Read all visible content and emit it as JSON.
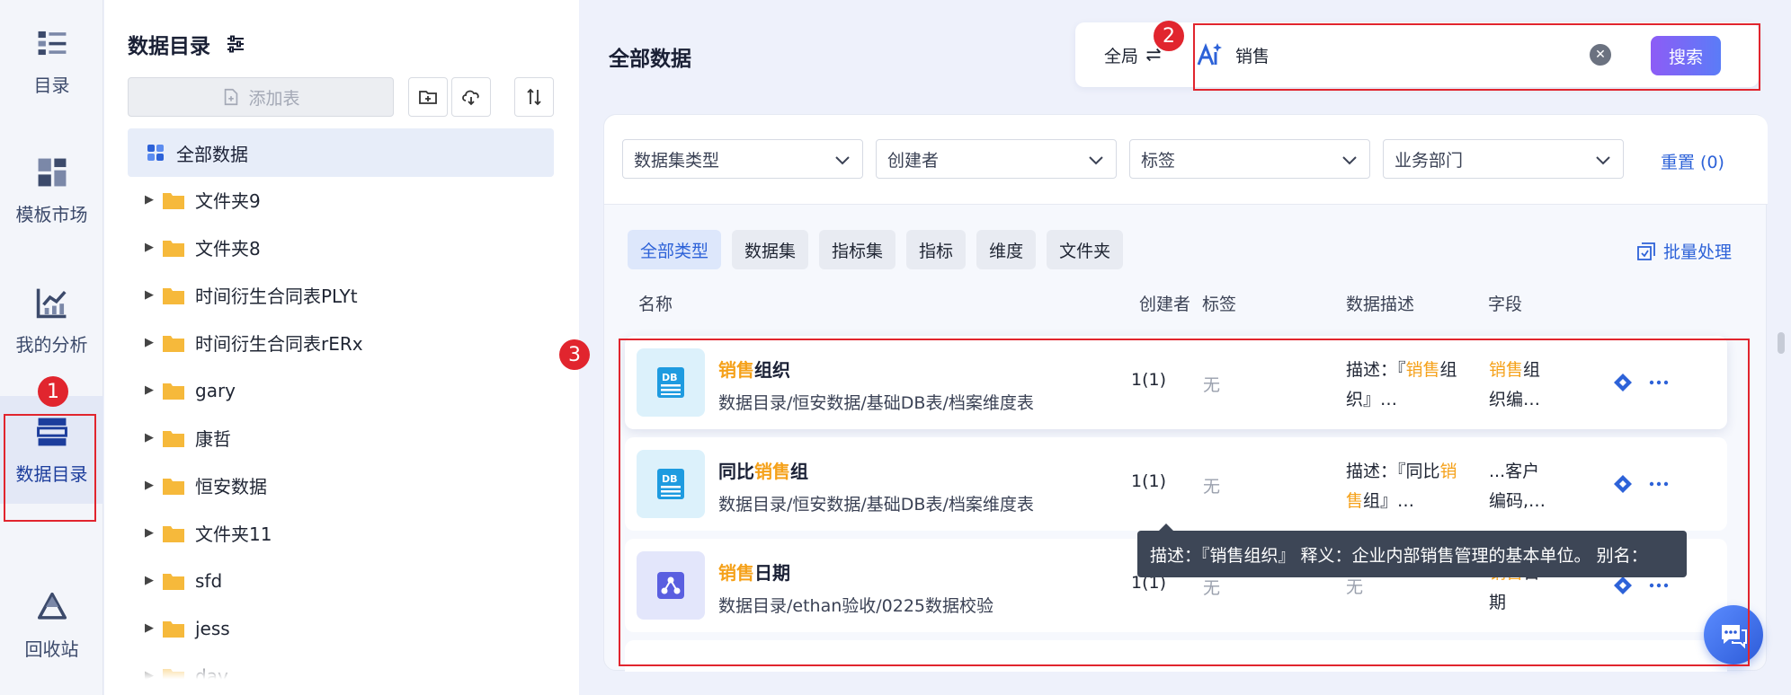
{
  "rail": {
    "items": [
      {
        "label": "目录",
        "icon": "catalog-list-icon"
      },
      {
        "label": "模板市场",
        "icon": "template-grid-icon"
      },
      {
        "label": "我的分析",
        "icon": "chart-analysis-icon"
      },
      {
        "label": "数据目录",
        "icon": "data-catalog-icon",
        "active": true
      },
      {
        "label": "回收站",
        "icon": "recycle-bin-icon"
      }
    ]
  },
  "tree": {
    "title": "数据目录",
    "add_table_label": "添加表",
    "all_label": "全部数据",
    "folders": [
      "文件夹9",
      "文件夹8",
      "时间衍生合同表PLYt",
      "时间衍生合同表rERx",
      "gary",
      "康哲",
      "恒安数据",
      "文件夹11",
      "sfd",
      "jess",
      "dav"
    ]
  },
  "main": {
    "title": "全部数据",
    "search": {
      "scope_label": "全局",
      "query": "销售",
      "button_label": "搜索"
    },
    "filters": [
      "数据集类型",
      "创建者",
      "标签",
      "业务部门"
    ],
    "reset_label": "重置 (0)",
    "type_tabs": [
      "全部类型",
      "数据集",
      "指标集",
      "指标",
      "维度",
      "文件夹"
    ],
    "batch_label": "批量处理",
    "columns": {
      "name": "名称",
      "creator": "创建者",
      "tags": "标签",
      "description": "数据描述",
      "fields": "字段"
    },
    "rows": [
      {
        "name_hl": "销售",
        "name_rest": "组织",
        "path": "数据目录/恒安数据/基础DB表/档案维度表",
        "creator": "1(1)",
        "tags": "无",
        "desc_line1_pre": "描述：『",
        "desc_line1_hl": "销售",
        "desc_line1_post": "组",
        "desc_line2": "织』…",
        "field_line1_hl": "销售",
        "field_line1_post": "组",
        "field_line2": "织编…",
        "icon": "db-table-icon"
      },
      {
        "name_pre": "同比",
        "name_hl": "销售",
        "name_rest": "组",
        "path": "数据目录/恒安数据/基础DB表/档案维度表",
        "creator": "1(1)",
        "tags": "无",
        "desc_line1_pre": "描述：『同比",
        "desc_line1_hl": "销",
        "desc_line2_hl": "售",
        "desc_line2": "组』…",
        "field_line1": "...客户",
        "field_line2": "编码,…",
        "icon": "db-table-icon"
      },
      {
        "name_hl": "销售",
        "name_rest": "日期",
        "path": "数据目录/ethan验收/0225数据校验",
        "creator": "1(1)",
        "tags": "无",
        "desc": "无",
        "field_line1_hl": "销售",
        "field_line1_post": "日",
        "field_line2": "期",
        "icon": "metric-node-icon"
      }
    ],
    "tooltip": "描述：『销售组织』 释义：企业内部销售管理的基本单位。 别名："
  },
  "annotations": [
    "1",
    "2",
    "3"
  ],
  "colors": {
    "accent": "#2d62d8",
    "highlight": "#f5a11a",
    "annotation": "#e1252e",
    "search_button_start": "#8d5cf6",
    "search_button_end": "#5b7cf7"
  }
}
